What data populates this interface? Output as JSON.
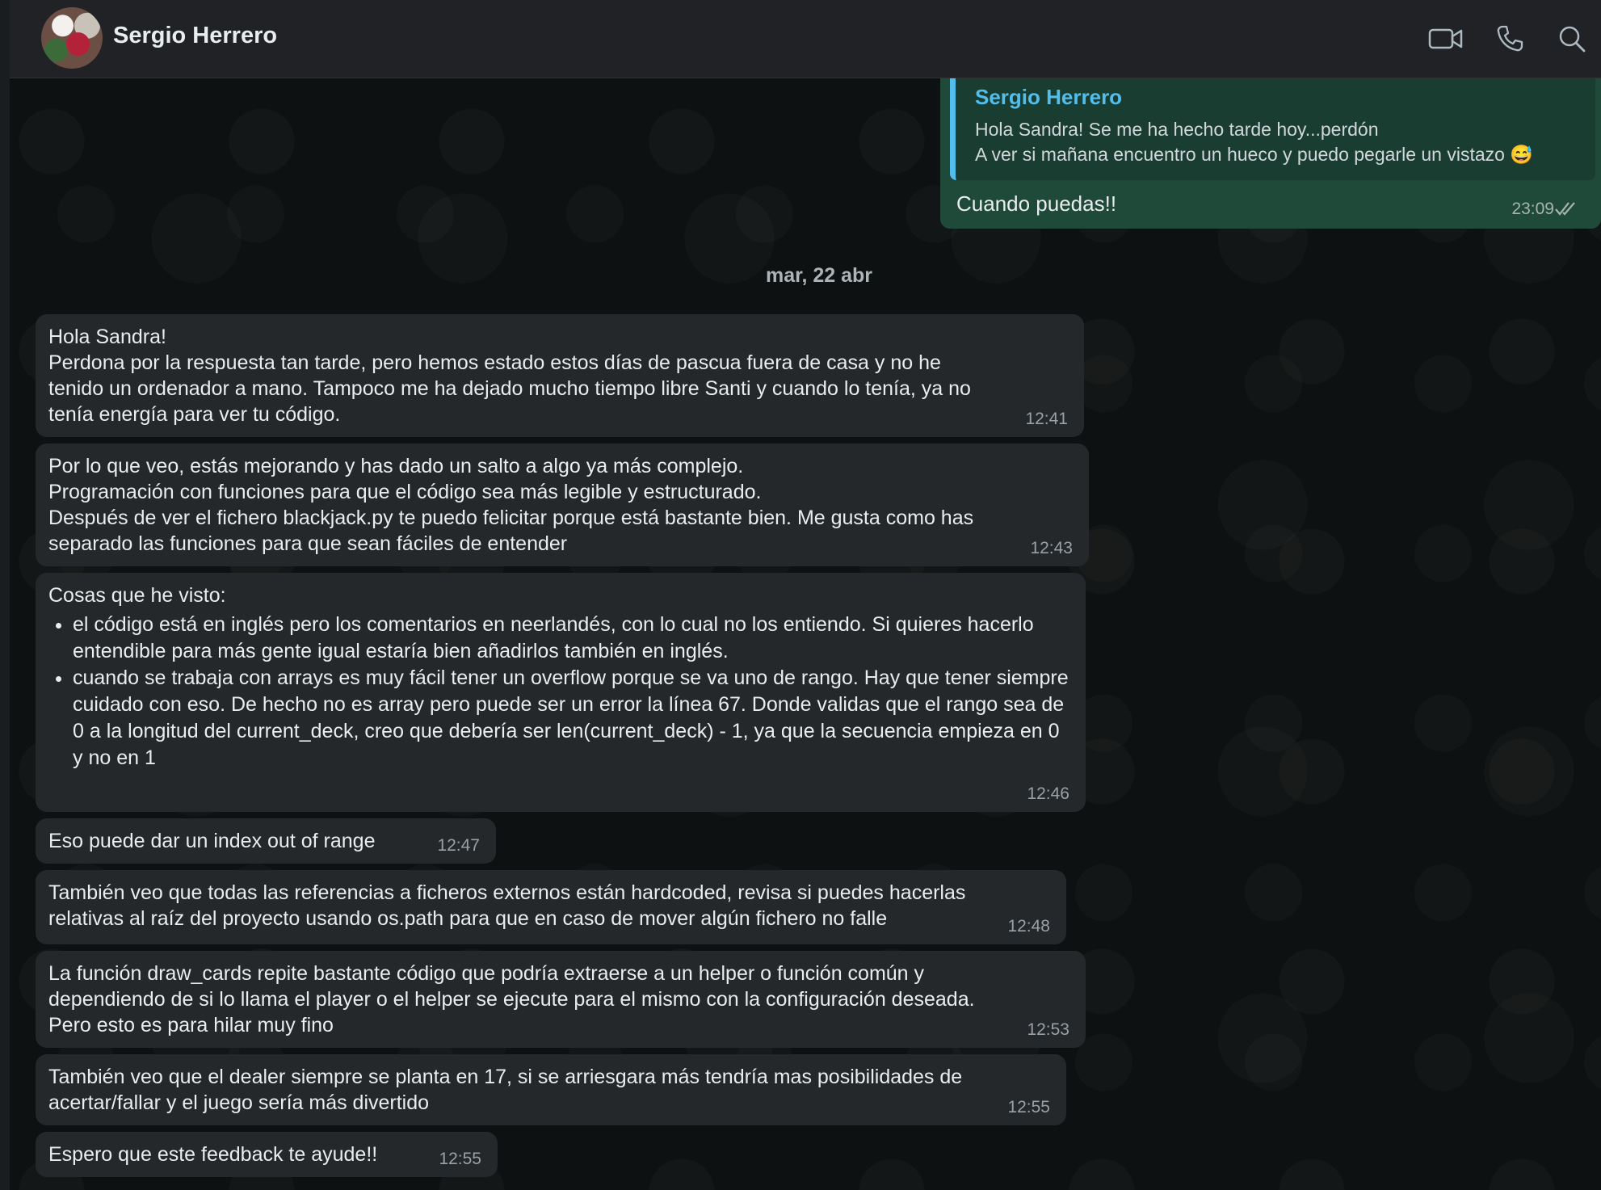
{
  "header": {
    "contact_name": "Sergio Herrero",
    "icons": [
      "video-call-icon",
      "voice-call-icon",
      "search-icon"
    ]
  },
  "outgoing": {
    "quote_author": "Sergio Herrero",
    "quote_text": "Hola Sandra! Se me ha hecho tarde hoy...perdón\nA ver si mañana encuentro un hueco y puedo pegarle un vistazo 😅",
    "text": "Cuando puedas!!",
    "time": "23:09"
  },
  "date_separator": "mar, 22 abr",
  "messages": [
    {
      "text": "Hola Sandra!\nPerdona por la respuesta tan tarde, pero hemos estado estos días de pascua fuera de casa y no he\ntenido un ordenador a mano. Tampoco me ha dejado mucho tiempo libre Santi y cuando lo tenía, ya no\ntenía energía para ver tu código.",
      "time": "12:41"
    },
    {
      "text": "Por lo que veo, estás mejorando y has dado un salto a algo ya más complejo.\nProgramación con funciones para que el código sea más legible y estructurado.\nDespués de ver el fichero blackjack.py te puedo felicitar porque está bastante bien. Me gusta como has\nseparado las funciones para que sean fáciles de entender",
      "time": "12:43"
    },
    {
      "text": "Cosas que he visto:",
      "bullets": [
        "el código está en inglés pero los comentarios en neerlandés, con lo cual no los entiendo. Si quieres hacerlo entendible para más gente igual estaría bien añadirlos también en inglés.",
        "cuando se trabaja con arrays es muy fácil tener un overflow porque se va uno de rango. Hay que tener siempre cuidado con eso. De hecho no es array pero puede ser un error la línea 67. Donde validas que el rango sea de 0 a la longitud del current_deck, creo que debería ser len(current_deck) - 1, ya que la secuencia empieza en 0 y no en 1"
      ],
      "time": "12:46"
    },
    {
      "text": "Eso puede dar un index out of range",
      "time": "12:47"
    },
    {
      "text": "También veo que todas las referencias a ficheros externos están hardcoded, revisa si puedes hacerlas\nrelativas al raíz del proyecto usando os.path para que en caso de mover algún fichero no falle",
      "time": "12:48"
    },
    {
      "text": "La función draw_cards repite bastante código que podría extraerse a un helper o función común y\ndependiendo de si lo llama el player o el helper se ejecute para el mismo con la configuración deseada.\nPero esto es para hilar muy fino",
      "time": "12:53"
    },
    {
      "text": "También veo que el dealer siempre se planta en 17, si se arriesgara más tendría mas posibilidades de\nacertar/fallar y el juego sería más divertido",
      "time": "12:55"
    },
    {
      "text": "Espero que este feedback te ayude!!",
      "time": "12:55"
    }
  ]
}
